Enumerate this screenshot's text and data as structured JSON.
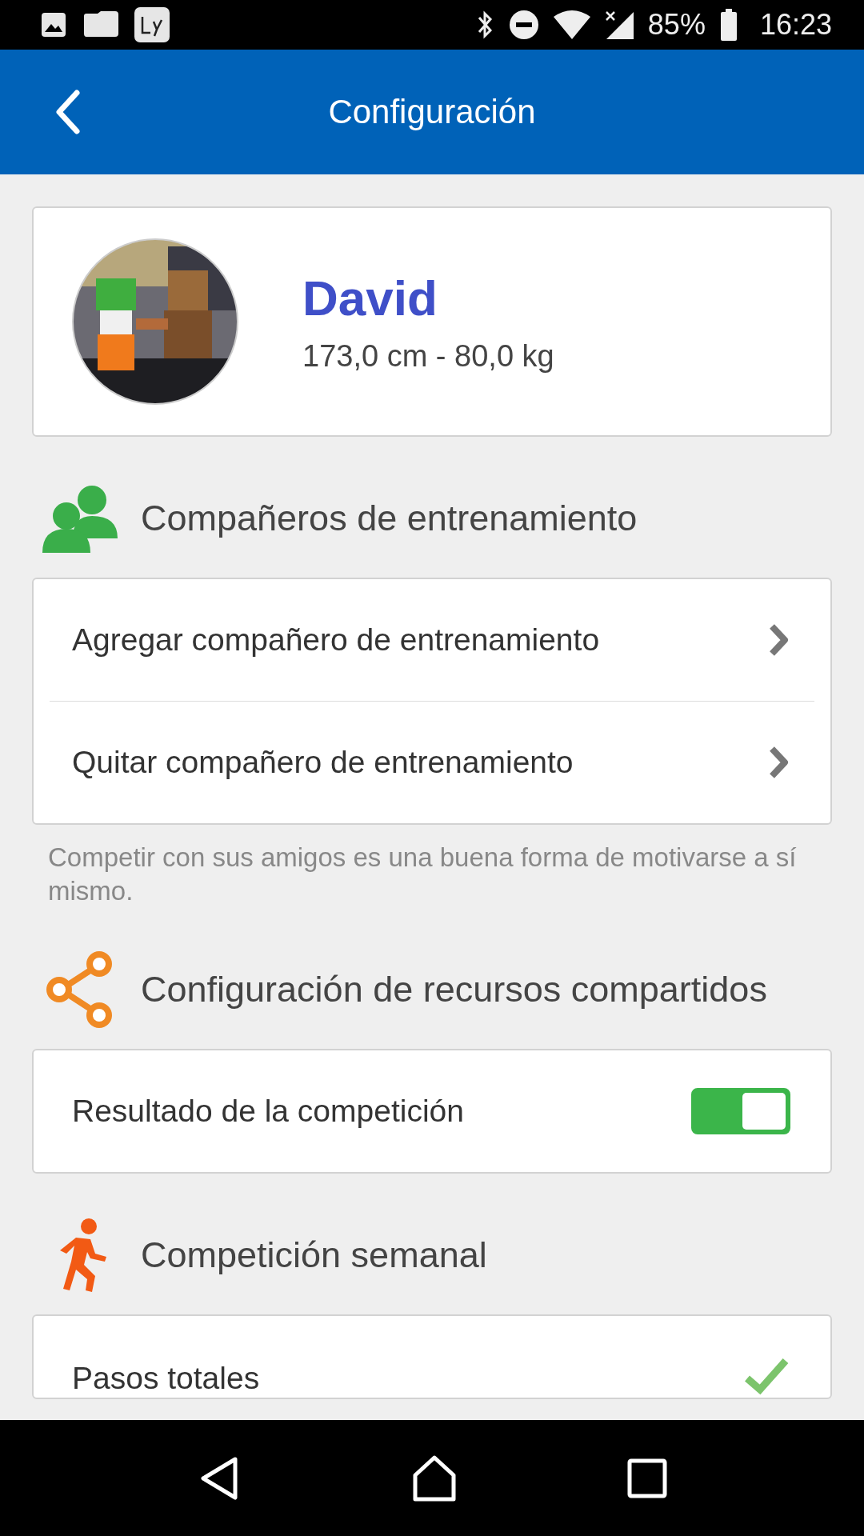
{
  "status_bar": {
    "battery": "85%",
    "time": "16:23"
  },
  "app_bar": {
    "title": "Configuración"
  },
  "profile": {
    "name": "David",
    "stats": "173,0 cm - 80,0 kg"
  },
  "sections": [
    {
      "kind": "partners",
      "title": "Compañeros de entrenamiento",
      "rows": [
        {
          "kind": "link",
          "label": "Agregar compañero de entrenamiento"
        },
        {
          "kind": "link",
          "label": "Quitar compañero de entrenamiento"
        }
      ],
      "note": "Competir con sus amigos es una buena forma de motivarse a sí mismo."
    },
    {
      "kind": "share",
      "title": "Configuración de recursos compartidos",
      "rows": [
        {
          "kind": "toggle",
          "label": "Resultado de la competición",
          "on": true
        }
      ]
    },
    {
      "kind": "run",
      "title": "Competición semanal",
      "rows": [
        {
          "kind": "check",
          "label": "Pasos totales",
          "checked": true
        }
      ]
    }
  ]
}
